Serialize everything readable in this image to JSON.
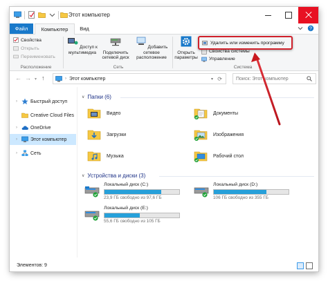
{
  "window": {
    "title": "Этот компьютер",
    "quick_access_icons": [
      "properties-icon",
      "new-folder-icon",
      "dropdown-icon"
    ]
  },
  "tabs": {
    "file": "Файл",
    "computer": "Компьютер",
    "view": "Вид"
  },
  "ribbon": {
    "location": {
      "label": "Расположение",
      "properties": "Свойства",
      "open": "Открыть",
      "rename": "Переименовать"
    },
    "network": {
      "label": "Сеть",
      "media_access": "Доступ к мультимедиа",
      "map_drive": "Подключить сетевой диск",
      "add_location": "Добавить сетевое расположение"
    },
    "system": {
      "label": "Система",
      "open_settings": "Открыть параметры",
      "uninstall": "Удалить или изменить программу",
      "system_properties": "Свойства системы",
      "manage": "Управление"
    }
  },
  "address": {
    "path": "Этот компьютер",
    "search_placeholder": "Поиск: Этот компьютер"
  },
  "nav_pane": {
    "items": [
      {
        "label": "Быстрый доступ",
        "icon": "star-icon"
      },
      {
        "label": "Creative Cloud Files",
        "icon": "folder-icon"
      },
      {
        "label": "OneDrive",
        "icon": "cloud-icon"
      },
      {
        "label": "Этот компьютер",
        "icon": "computer-icon"
      },
      {
        "label": "Сеть",
        "icon": "network-icon"
      }
    ]
  },
  "folders": {
    "header": "Папки (6)",
    "items": [
      {
        "name": "Видео",
        "icon": "video-folder-icon"
      },
      {
        "name": "Документы",
        "icon": "documents-folder-icon"
      },
      {
        "name": "Загрузки",
        "icon": "downloads-folder-icon"
      },
      {
        "name": "Изображения",
        "icon": "pictures-folder-icon"
      },
      {
        "name": "Музыка",
        "icon": "music-folder-icon"
      },
      {
        "name": "Рабочий стол",
        "icon": "desktop-folder-icon"
      }
    ]
  },
  "drives": {
    "header": "Устройства и диски (3)",
    "items": [
      {
        "name": "Локальный диск (C:)",
        "info": "23,9 ГБ свободно из 97,6 ГБ",
        "used_fraction": 0.76
      },
      {
        "name": "Локальный диск (D:)",
        "info": "106 ГБ свободно из 355 ГБ",
        "used_fraction": 0.7
      },
      {
        "name": "Локальный диск (E:)",
        "info": "55,6 ГБ свободно из 105 ГБ",
        "used_fraction": 0.47
      }
    ]
  },
  "status": {
    "items": "Элементов: 9"
  },
  "colors": {
    "accent": "#1979ca",
    "highlight": "#d0212b",
    "drive_bar": "#26a0da",
    "selection": "#cce8ff"
  }
}
